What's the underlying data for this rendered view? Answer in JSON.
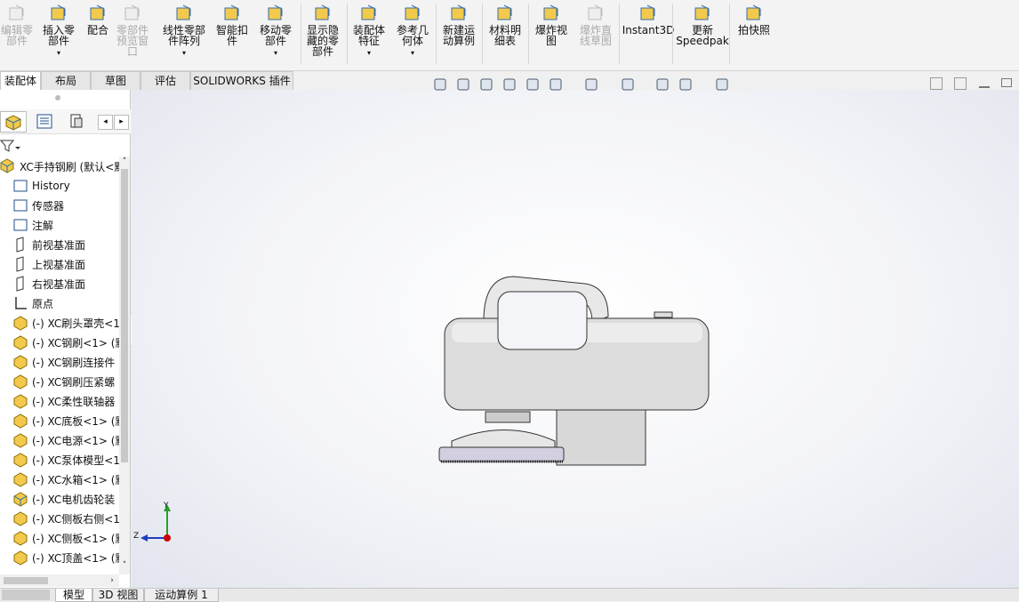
{
  "ribbon": {
    "buttons": [
      {
        "label": "编辑零\n部件",
        "icon": "edit-component-icon",
        "disabled": true
      },
      {
        "label": "插入零\n部件",
        "icon": "insert-component-icon",
        "disabled": false
      },
      {
        "label": "配合",
        "icon": "mate-icon",
        "disabled": false
      },
      {
        "label": "零部件\n预览窗\n口",
        "icon": "component-preview-icon",
        "disabled": true
      },
      {
        "label": "线性零部\n件阵列",
        "icon": "linear-pattern-icon",
        "disabled": false
      },
      {
        "label": "智能扣\n件",
        "icon": "smart-fastener-icon",
        "disabled": false
      },
      {
        "label": "移动零\n部件",
        "icon": "move-component-icon",
        "disabled": false
      },
      {
        "label": "显示隐\n藏的零\n部件",
        "icon": "show-hidden-icon",
        "disabled": false
      },
      {
        "label": "装配体\n特征",
        "icon": "assembly-feature-icon",
        "disabled": false
      },
      {
        "label": "参考几\n何体",
        "icon": "reference-geometry-icon",
        "disabled": false
      },
      {
        "label": "新建运\n动算例",
        "icon": "motion-study-icon",
        "disabled": false
      },
      {
        "label": "材料明\n细表",
        "icon": "bom-icon",
        "disabled": false
      },
      {
        "label": "爆炸视\n图",
        "icon": "exploded-view-icon",
        "disabled": false
      },
      {
        "label": "爆炸直\n线草图",
        "icon": "explode-line-icon",
        "disabled": true
      },
      {
        "label": "Instant3D",
        "icon": "instant3d-icon",
        "disabled": false
      },
      {
        "label": "更新\nSpeedpak",
        "icon": "speedpak-icon",
        "disabled": false
      },
      {
        "label": "拍快照",
        "icon": "snapshot-icon",
        "disabled": false
      }
    ]
  },
  "tabs": [
    "装配体",
    "布局",
    "草图",
    "评估",
    "SOLIDWORKS 插件"
  ],
  "tree": {
    "root": "XC手持钢刷  (默认<默",
    "items": [
      {
        "label": "History",
        "icon": "history-icon"
      },
      {
        "label": "传感器",
        "icon": "sensor-icon"
      },
      {
        "label": "注解",
        "icon": "annotation-icon"
      },
      {
        "label": "前视基准面",
        "icon": "plane-icon"
      },
      {
        "label": "上视基准面",
        "icon": "plane-icon"
      },
      {
        "label": "右视基准面",
        "icon": "plane-icon"
      },
      {
        "label": "原点",
        "icon": "origin-icon"
      },
      {
        "label": "(-) XC刷头罩壳<1",
        "icon": "part-icon"
      },
      {
        "label": "(-) XC钢刷<1> (默",
        "icon": "part-icon"
      },
      {
        "label": "(-) XC钢刷连接件",
        "icon": "part-icon"
      },
      {
        "label": "(-) XC钢刷压紧螺",
        "icon": "part-icon"
      },
      {
        "label": "(-) XC柔性联轴器",
        "icon": "part-icon"
      },
      {
        "label": "(-) XC底板<1> (默",
        "icon": "part-icon"
      },
      {
        "label": "(-) XC电源<1> (默",
        "icon": "part-icon"
      },
      {
        "label": "(-) XC泵体模型<1",
        "icon": "part-icon"
      },
      {
        "label": "(-) XC水箱<1> (默",
        "icon": "part-icon"
      },
      {
        "label": "(-) XC电机齿轮装",
        "icon": "subassembly-icon"
      },
      {
        "label": "(-) XC侧板右侧<1",
        "icon": "part-icon"
      },
      {
        "label": "(-) XC侧板<1> (默",
        "icon": "part-icon"
      },
      {
        "label": "(-) XC顶盖<1> (默",
        "icon": "part-icon"
      }
    ]
  },
  "bottom_tabs": [
    "模型",
    "3D 视图",
    "运动算例 1"
  ],
  "triad": {
    "y": "Y",
    "z": "Z"
  }
}
